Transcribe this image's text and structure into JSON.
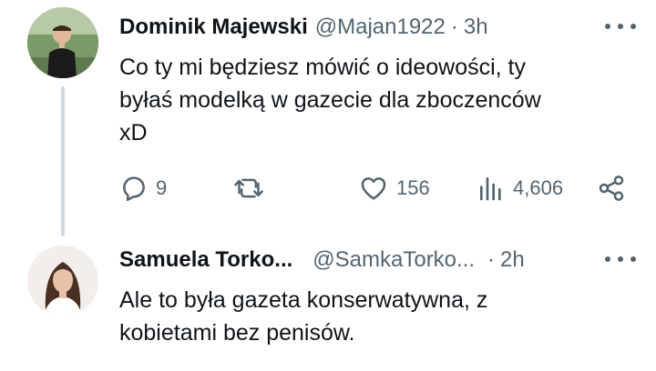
{
  "tweets": [
    {
      "name": "Dominik Majewski",
      "handle": "@Majan1922",
      "dot": "·",
      "time": "3h",
      "text_lines": [
        "Co ty mi będziesz mówić o ideowości, ty",
        "byłaś modelką w gazecie dla zboczenców",
        "xD"
      ],
      "actions": {
        "replies": "9",
        "reposts": "",
        "likes": "156",
        "views": "4,606"
      }
    },
    {
      "name": "Samuela Torko...",
      "handle": "@SamkaTorko...",
      "dot": "·",
      "time": "2h",
      "text_lines": [
        "Ale to była gazeta konserwatywna, z",
        "kobietami bez penisów."
      ]
    }
  ],
  "icons": {
    "reply": "reply-icon",
    "repost": "repost-icon",
    "like": "heart-icon",
    "views": "views-icon",
    "share": "share-icon",
    "more": "more-icon"
  },
  "colors": {
    "text": "#0f1419",
    "secondary": "#536471",
    "thread_line": "#cfd9de"
  }
}
